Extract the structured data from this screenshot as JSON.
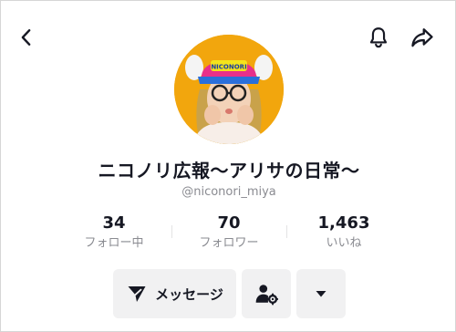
{
  "header": {
    "back_icon": "chevron-left-icon",
    "notification_icon": "bell-icon",
    "share_icon": "share-arrow-icon"
  },
  "profile": {
    "display_name": "ニコノリ広報〜アリサの日常〜",
    "username": "@niconori_miya",
    "avatar_cap_text": "NICONORI"
  },
  "stats": [
    {
      "value": "34",
      "label": "フォロー中"
    },
    {
      "value": "70",
      "label": "フォロワー"
    },
    {
      "value": "1,463",
      "label": "いいね"
    }
  ],
  "actions": {
    "message_label": "メッセージ",
    "message_icon": "send-icon",
    "follow_settings_icon": "user-gear-icon",
    "more_icon": "caret-down-icon"
  },
  "colors": {
    "text_primary": "#161823",
    "text_secondary": "#8a8b91",
    "button_bg": "#f1f1f2",
    "avatar_bg": "#f2a60d",
    "cap_pink": "#e8308a",
    "cap_brim": "#2a6fdb"
  }
}
